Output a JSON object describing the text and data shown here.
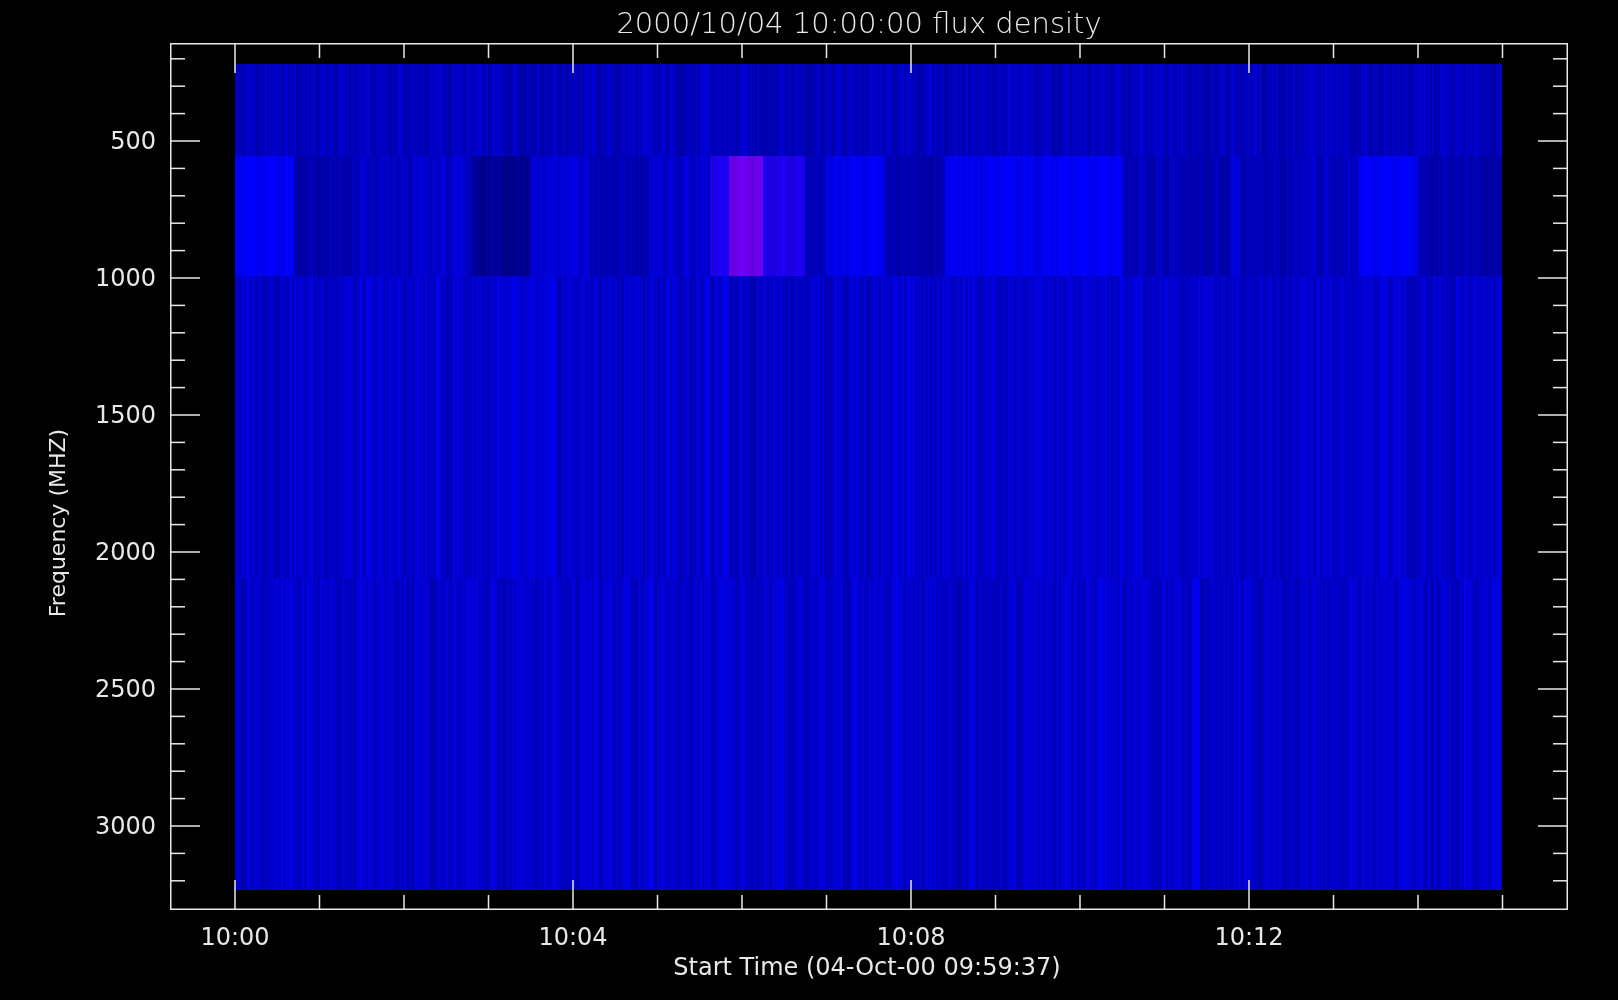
{
  "plot": {
    "title": "2000/10/04 10:00:00 flux density",
    "ylabel": "Frequency (MHZ)",
    "xlabel": "Start Time (04-Oct-00 09:59:37)",
    "yticks": [
      "500",
      "1000",
      "1500",
      "2000",
      "2500",
      "3000"
    ],
    "xticks": [
      "10:00",
      "10:04",
      "10:08",
      "10:12"
    ]
  }
}
